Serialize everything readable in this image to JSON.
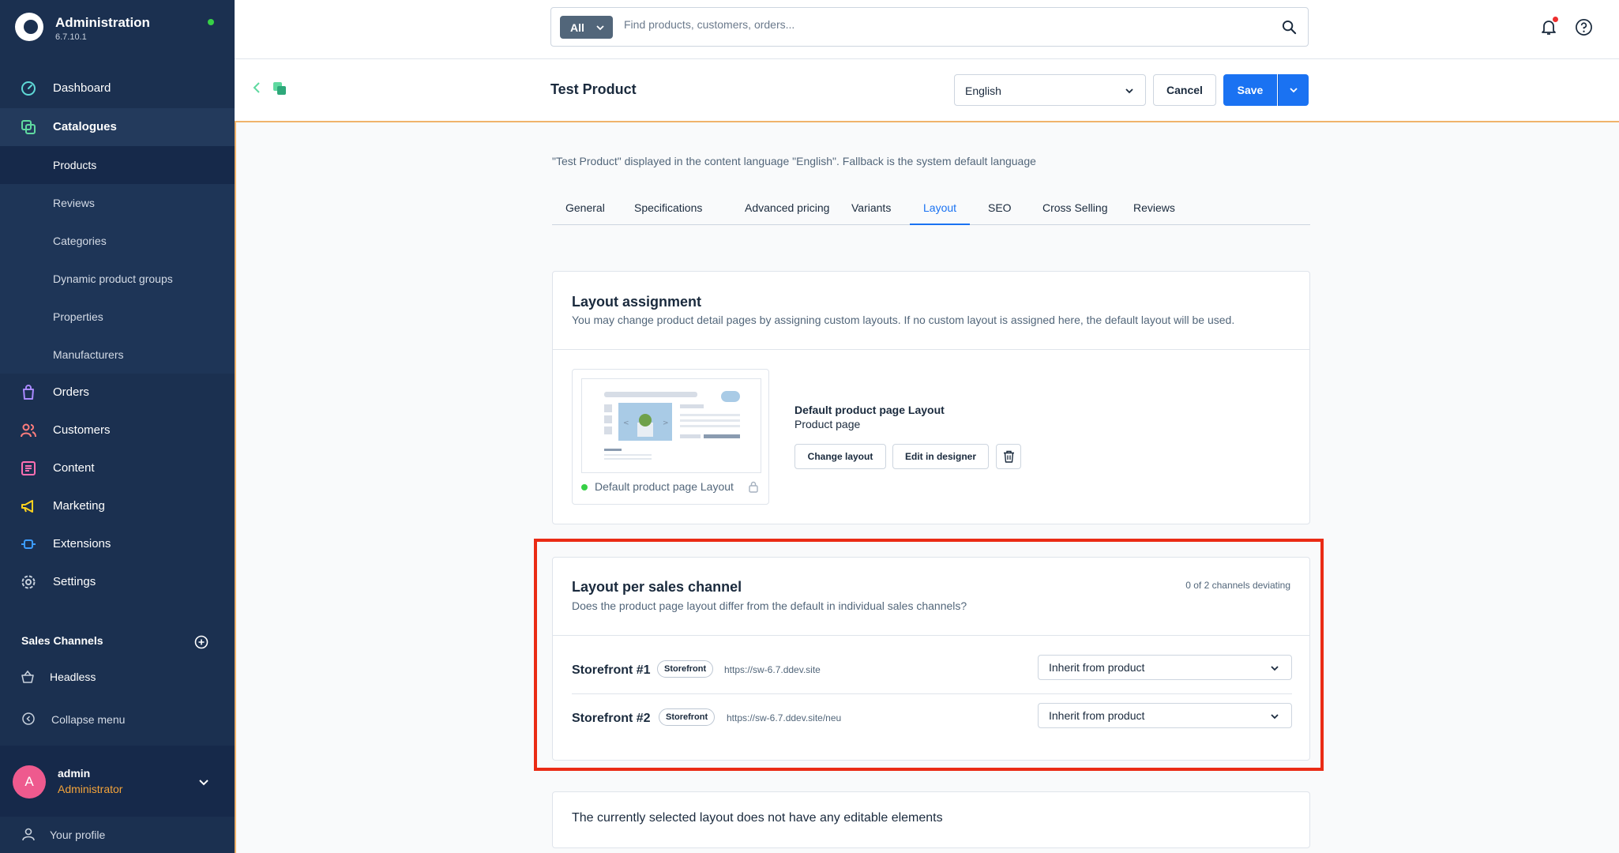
{
  "sidebar": {
    "app_name": "Administration",
    "version": "6.7.10.1",
    "nav": [
      {
        "label": "Dashboard",
        "icon": "dashboard-icon",
        "color": "#5fd9d6"
      },
      {
        "label": "Catalogues",
        "icon": "catalogue-icon",
        "color": "#5fd9a0"
      },
      {
        "label": "Orders",
        "icon": "orders-icon",
        "color": "#a98aff"
      },
      {
        "label": "Customers",
        "icon": "customers-icon",
        "color": "#ff7d7d"
      },
      {
        "label": "Content",
        "icon": "content-icon",
        "color": "#ff6fb2"
      },
      {
        "label": "Marketing",
        "icon": "marketing-icon",
        "color": "#ffd21e"
      },
      {
        "label": "Extensions",
        "icon": "extensions-icon",
        "color": "#3c9cff"
      },
      {
        "label": "Settings",
        "icon": "settings-icon",
        "color": "#c7d0dc"
      }
    ],
    "catalogue_items": [
      "Products",
      "Reviews",
      "Categories",
      "Dynamic product groups",
      "Properties",
      "Manufacturers"
    ],
    "sales_channels_title": "Sales Channels",
    "sales_channel_item": "Headless",
    "collapse_label": "Collapse menu",
    "user": {
      "initial": "A",
      "name": "admin",
      "role": "Administrator"
    },
    "profile_label": "Your profile"
  },
  "topbar": {
    "search_filter": "All",
    "search_placeholder": "Find products, customers, orders..."
  },
  "smartbar": {
    "title": "Test Product",
    "language": "English",
    "cancel_label": "Cancel",
    "save_label": "Save"
  },
  "content": {
    "info": "\"Test Product\" displayed in the content language \"English\". Fallback is the system default language",
    "tabs": [
      "General",
      "Specifications",
      "Advanced pricing",
      "Variants",
      "Layout",
      "SEO",
      "Cross Selling",
      "Reviews"
    ],
    "active_tab": "Layout",
    "layout_assignment": {
      "title": "Layout assignment",
      "subtitle": "You may change product detail pages by assigning custom layouts. If no custom layout is assigned here, the default layout will be used.",
      "preview_name": "Default product page Layout",
      "layout_name": "Default product page Layout",
      "layout_type": "Product page",
      "change_label": "Change layout",
      "edit_label": "Edit in designer"
    },
    "per_channel": {
      "title": "Layout per sales channel",
      "subtitle": "Does the product page layout differ from the default in individual sales channels?",
      "deviating": "0 of 2 channels deviating",
      "channels": [
        {
          "name": "Storefront #1",
          "badge": "Storefront",
          "url": "https://sw-6.7.ddev.site",
          "selection": "Inherit from product"
        },
        {
          "name": "Storefront #2",
          "badge": "Storefront",
          "url": "https://sw-6.7.ddev.site/neu",
          "selection": "Inherit from product"
        }
      ]
    },
    "note": "The currently selected layout does not have any editable elements"
  }
}
